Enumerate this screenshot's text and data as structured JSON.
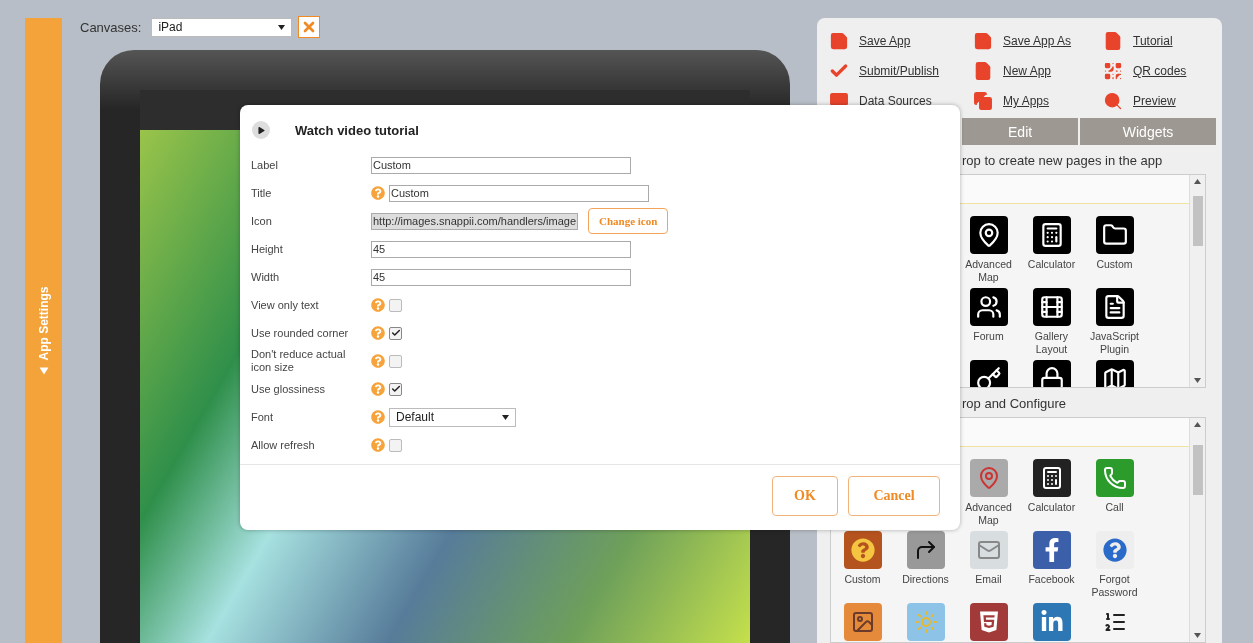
{
  "sidebar": {
    "label": "App Settings",
    "collapsed": true
  },
  "canvas_bar": {
    "label": "Canvases:",
    "value": "iPad"
  },
  "toolbar": [
    {
      "label": "Save App"
    },
    {
      "label": "Submit/Publish"
    },
    {
      "label": "Data Sources"
    },
    {
      "label": "Save App As"
    },
    {
      "label": "New App"
    },
    {
      "label": "My Apps"
    },
    {
      "label": "Tutorial"
    },
    {
      "label": "QR codes"
    },
    {
      "label": "Preview"
    }
  ],
  "tabs": [
    {
      "label": "Edit",
      "selected": false
    },
    {
      "label": "Widgets",
      "selected": false
    }
  ],
  "sections": [
    {
      "title": "rop to create new pages in the app",
      "rows": [
        [
          "",
          "",
          {
            "kind": "labeled",
            "label": "Advanced Map"
          },
          {
            "kind": "labeled",
            "label": "Calculator"
          },
          {
            "kind": "labeled",
            "label": "Custom"
          }
        ],
        [
          "",
          "",
          {
            "kind": "labeled",
            "label": "Forum"
          },
          {
            "kind": "labeled",
            "label": "Gallery Layout"
          },
          {
            "kind": "labeled",
            "label": "JavaScript Plugin"
          }
        ],
        [
          "",
          "",
          {
            "kind": "icon"
          },
          {
            "kind": "icon"
          },
          {
            "kind": "icon"
          }
        ]
      ]
    },
    {
      "title": "rop and Configure",
      "rows": [
        [
          "",
          "",
          {
            "kind": "labeled",
            "label": "Advanced Map"
          },
          {
            "kind": "labeled",
            "label": "Calculator"
          },
          {
            "kind": "labeled",
            "label": "Call"
          }
        ],
        [
          {
            "kind": "labeled",
            "label": "Custom"
          },
          {
            "kind": "labeled",
            "label": "Directions"
          },
          {
            "kind": "labeled",
            "label": "Email"
          },
          {
            "kind": "labeled",
            "label": "Facebook"
          },
          {
            "kind": "labeled",
            "label": "Forgot Password"
          }
        ],
        [
          {
            "kind": "icon"
          },
          {
            "kind": "icon"
          },
          {
            "kind": "icon"
          },
          {
            "kind": "icon"
          },
          {
            "kind": "icon"
          }
        ]
      ]
    }
  ],
  "dialog": {
    "title": "Watch video tutorial",
    "fields": [
      {
        "kind": "text",
        "label": "Label",
        "help": false,
        "value": "Custom"
      },
      {
        "kind": "text",
        "label": "Title",
        "help": true,
        "value": "Custom"
      },
      {
        "kind": "icon_url",
        "label": "Icon",
        "help": false,
        "value": "http://images.snappii.com/handlers/image",
        "button": "Change icon"
      },
      {
        "kind": "text",
        "label": "Height",
        "help": false,
        "value": "45"
      },
      {
        "kind": "text",
        "label": "Width",
        "help": false,
        "value": "45"
      },
      {
        "kind": "checkbox",
        "label": "View only text",
        "help": true,
        "checked": false
      },
      {
        "kind": "checkbox",
        "label": "Use rounded corner",
        "help": true,
        "checked": true
      },
      {
        "kind": "checkbox",
        "label": "Don't reduce actual icon size",
        "help": true,
        "checked": false
      },
      {
        "kind": "checkbox",
        "label": "Use glossiness",
        "help": true,
        "checked": true
      },
      {
        "kind": "select",
        "label": "Font",
        "help": true,
        "value": "Default"
      },
      {
        "kind": "checkbox",
        "label": "Allow refresh",
        "help": true,
        "checked": false
      }
    ],
    "buttons": [
      "OK",
      "Cancel"
    ]
  }
}
